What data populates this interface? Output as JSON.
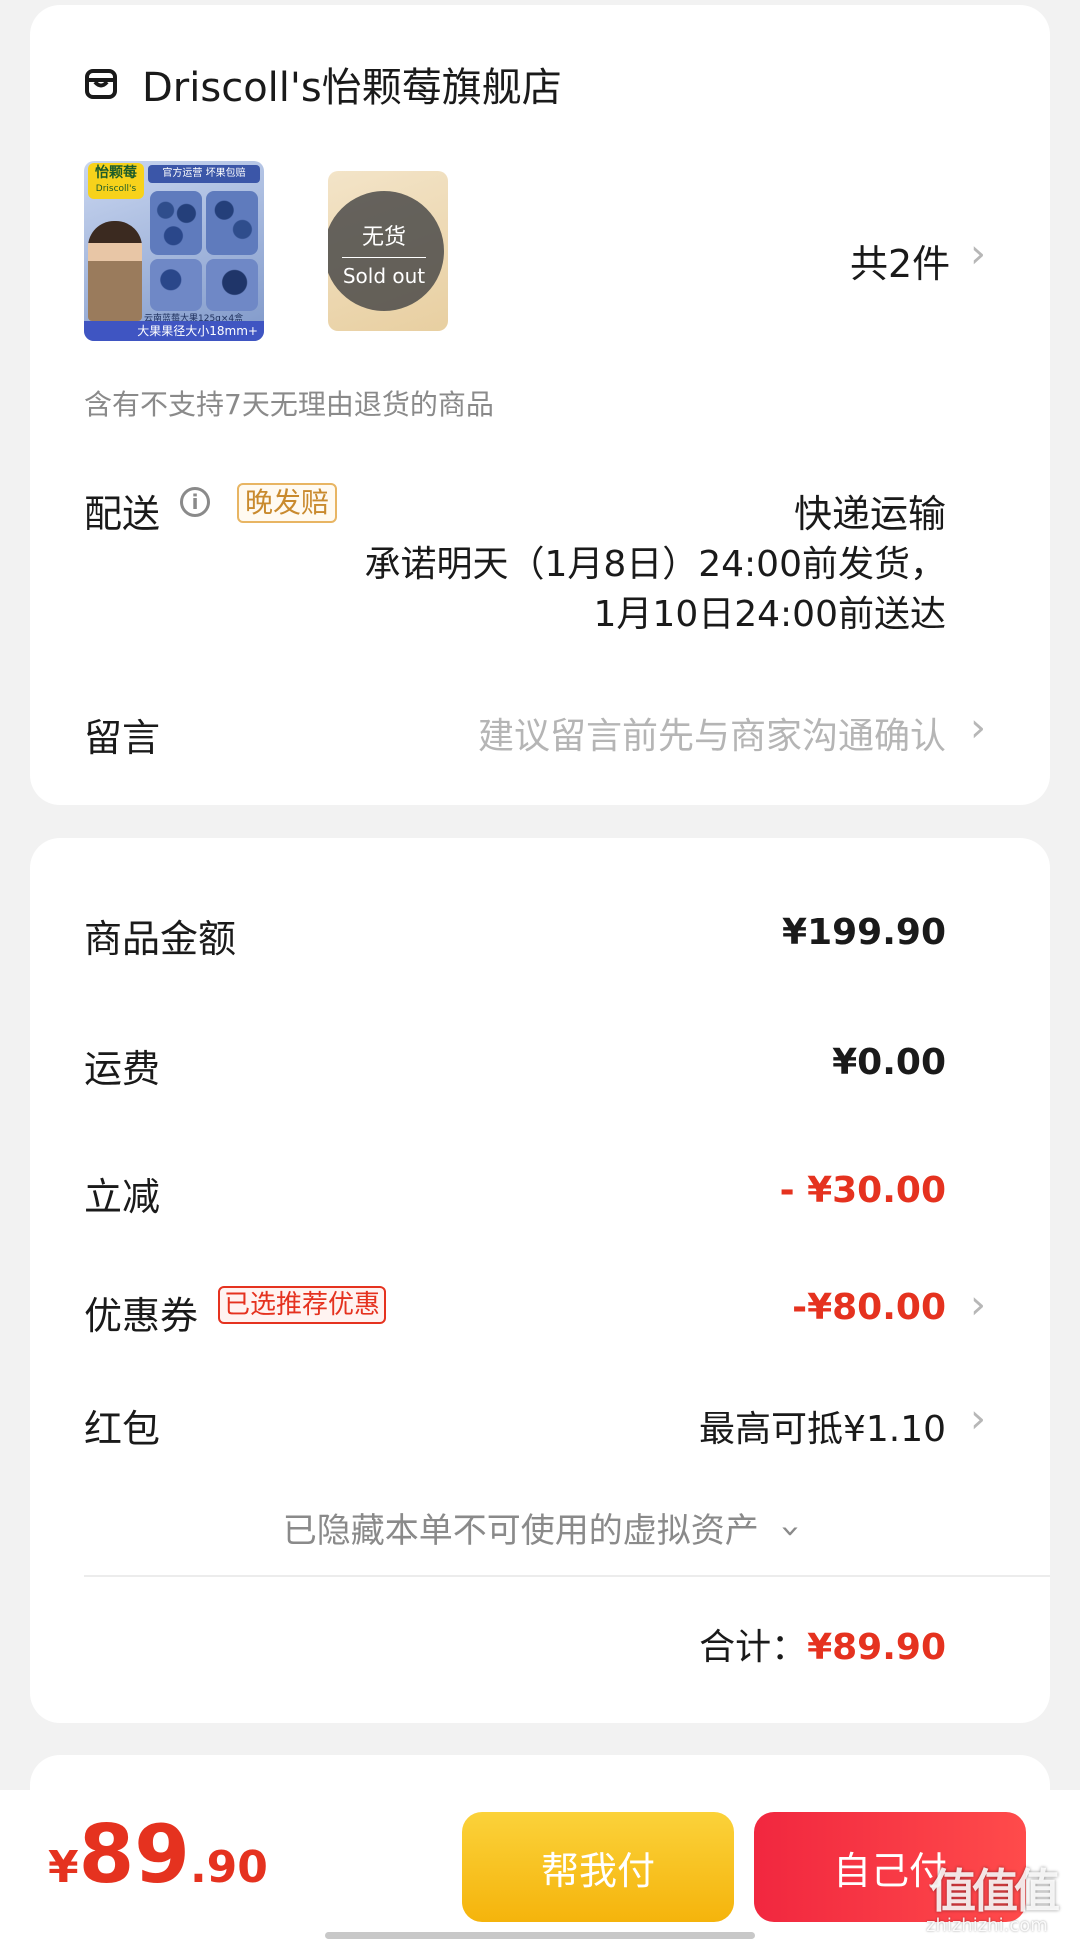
{
  "store": {
    "name": "Driscoll's怡颗莓旗舰店"
  },
  "products": {
    "count_label": "共2件",
    "item1": {
      "brand": "怡颗莓",
      "brand_sub": "Driscoll's",
      "banner": "官方运营 坏果包赔",
      "spec": "云南蓝莓大果125g×4盒",
      "footer": "大果果径大小18mm+"
    },
    "item2": {
      "sold_out_cn": "无货",
      "sold_out_en": "Sold out"
    },
    "return_notice": "含有不支持7天无理由退货的商品"
  },
  "delivery": {
    "label": "配送",
    "badge": "晚发赔",
    "method": "快递运输",
    "promise_line1": "承诺明天（1月8日）24:00前发货，",
    "promise_line2": "1月10日24:00前送达"
  },
  "message": {
    "label": "留言",
    "placeholder": "建议留言前先与商家沟通确认"
  },
  "price": {
    "goods_label": "商品金额",
    "goods_value": "¥199.90",
    "shipping_label": "运费",
    "shipping_value": "¥0.00",
    "discount_label": "立减",
    "discount_value": "- ¥30.00",
    "coupon_label": "优惠券",
    "coupon_badge": "已选推荐优惠",
    "coupon_value": "-¥80.00",
    "redpacket_label": "红包",
    "redpacket_value": "最高可抵¥1.10",
    "hidden_assets": "已隐藏本单不可使用的虚拟资产",
    "total_label": "合计：",
    "total_value": "¥89.90"
  },
  "bottom": {
    "currency": "¥",
    "amount_int": "89",
    "amount_dec": ".90",
    "help_pay": "帮我付",
    "self_pay": "自己付"
  },
  "watermark": {
    "logo": "值值值",
    "url": "zhizhizhi.com"
  },
  "colors": {
    "accent_red": "#e5321f",
    "help_pay": "#f9c01a",
    "self_pay": "#f53d4d",
    "badge_orange": "#c98a2e"
  }
}
